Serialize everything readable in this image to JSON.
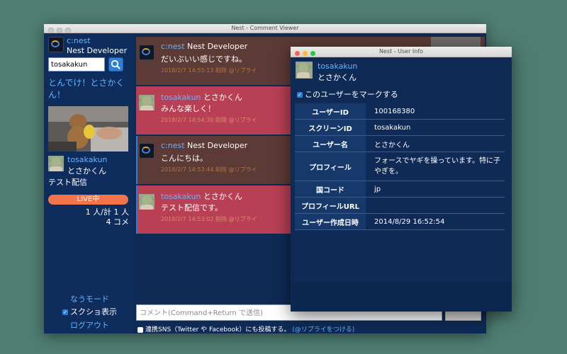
{
  "main_window": {
    "title": "Nest - Comment Viewer"
  },
  "sidebar": {
    "account_name": "c:nest",
    "account_display": "Nest Developer",
    "search": {
      "value": "tosakakun",
      "placeholder": ""
    },
    "live_title": "とんでけ！とさかくん！",
    "caster_id": "tosakakun",
    "caster_name": "とさかくん",
    "program_label": "テスト配信",
    "live_badge": "LIVE中",
    "viewers": "1 人/計 1 人",
    "comments": "4 コメ",
    "now_mode": "なうモード",
    "screenshot_label": "スクショ表示",
    "logout": "ログアウト"
  },
  "messages": [
    {
      "user": "c:nest",
      "name": "Nest Developer",
      "text": "だいぶいい感じですね。",
      "meta": "2018/2/7 14:55:13 削除 @リプライ",
      "color": "brown"
    },
    {
      "user": "tosakakun",
      "name": "とさかくん",
      "text": "みんな楽しく！",
      "meta": "2018/2/7 14:54:30 削除 @リプライ",
      "color": "red"
    },
    {
      "user": "c:nest",
      "name": "Nest Developer",
      "text": "こんにちは。",
      "meta": "2018/2/7 14:53:44 削除 @リプライ",
      "color": "brown"
    },
    {
      "user": "tosakakun",
      "name": "とさかくん",
      "text": "テスト配信です。",
      "meta": "2018/2/7 14:53:02 削除 @リプライ",
      "color": "red"
    }
  ],
  "comment_box": {
    "placeholder": "コメント(Command+Return で送信)"
  },
  "sns_row": {
    "label": "連携SNS（Twitter や Facebook）にも投稿する。",
    "reply_link": "(@リプライをつける)"
  },
  "info_window": {
    "title": "Nest - User Info",
    "user_id": "tosakakun",
    "user_name": "とさかくん",
    "mark_label": "このユーザーをマークする",
    "rows": [
      {
        "key": "ユーザーID",
        "value": "100168380"
      },
      {
        "key": "スクリーンID",
        "value": "tosakakun"
      },
      {
        "key": "ユーザー名",
        "value": "とさかくん"
      },
      {
        "key": "プロフィール",
        "value": "フォースでヤギを操っています。特に子やぎを。"
      },
      {
        "key": "国コード",
        "value": "jp"
      },
      {
        "key": "プロフィールURL",
        "value": ""
      },
      {
        "key": "ユーザー作成日時",
        "value": "2014/8/29 16:52:54"
      }
    ]
  }
}
